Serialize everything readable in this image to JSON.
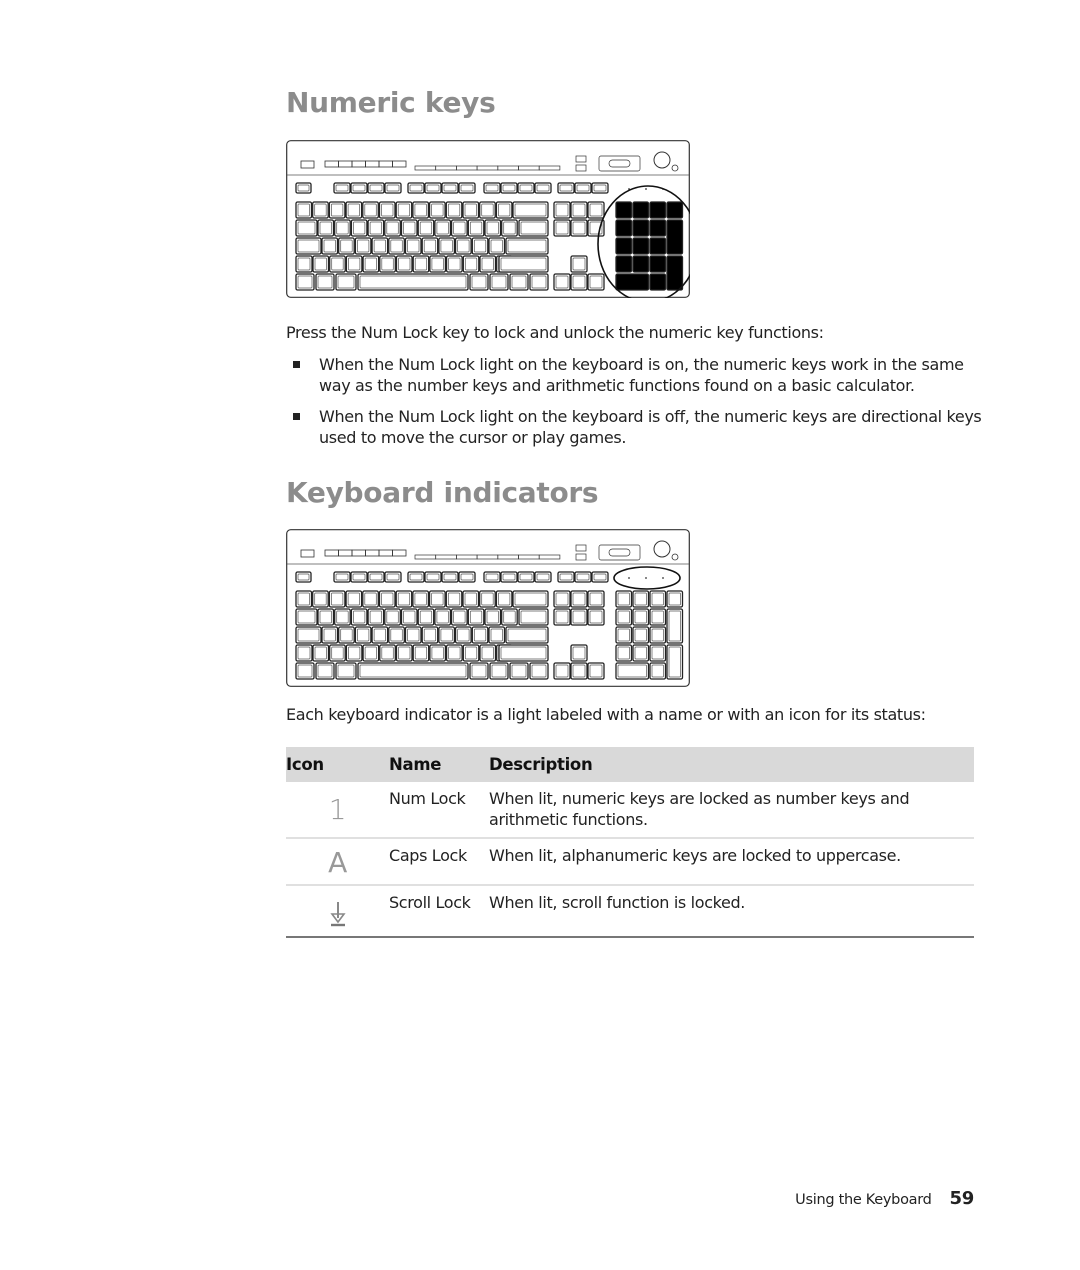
{
  "sections": {
    "numeric": {
      "heading": "Numeric keys",
      "figure": {
        "name": "keyboard-numeric-keypad-highlight",
        "highlight": "numeric-keypad"
      },
      "intro": "Press the Num Lock key to lock and unlock the numeric key functions:",
      "bullets": [
        "When the Num Lock light on the keyboard is on, the numeric keys work in the same way as the number keys and arithmetic functions found on a basic calculator.",
        "When the Num Lock light on the keyboard is off, the numeric keys are directional keys used to move the cursor or play games."
      ]
    },
    "indicators": {
      "heading": "Keyboard indicators",
      "figure": {
        "name": "keyboard-indicator-lights-highlight",
        "highlight": "indicator-lights"
      },
      "intro": "Each keyboard indicator is a light labeled with a name or with an icon for its status:",
      "table": {
        "headers": {
          "icon": "Icon",
          "name": "Name",
          "description": "Description"
        },
        "rows": [
          {
            "icon": "num-lock-icon",
            "glyph": "1",
            "name": "Num Lock",
            "description": "When lit, numeric keys are locked as number keys and arithmetic functions."
          },
          {
            "icon": "caps-lock-icon",
            "glyph": "A",
            "name": "Caps Lock",
            "description": "When lit, alphanumeric keys are locked to uppercase."
          },
          {
            "icon": "scroll-lock-icon",
            "glyph": "↓",
            "name": "Scroll Lock",
            "description": "When lit, scroll function is locked."
          }
        ]
      }
    }
  },
  "footer": {
    "section_title": "Using the Keyboard",
    "page_number": "59"
  },
  "colors": {
    "heading": "#8c8c8c",
    "table_header_bg": "#d9d9d9",
    "text": "#222222"
  }
}
